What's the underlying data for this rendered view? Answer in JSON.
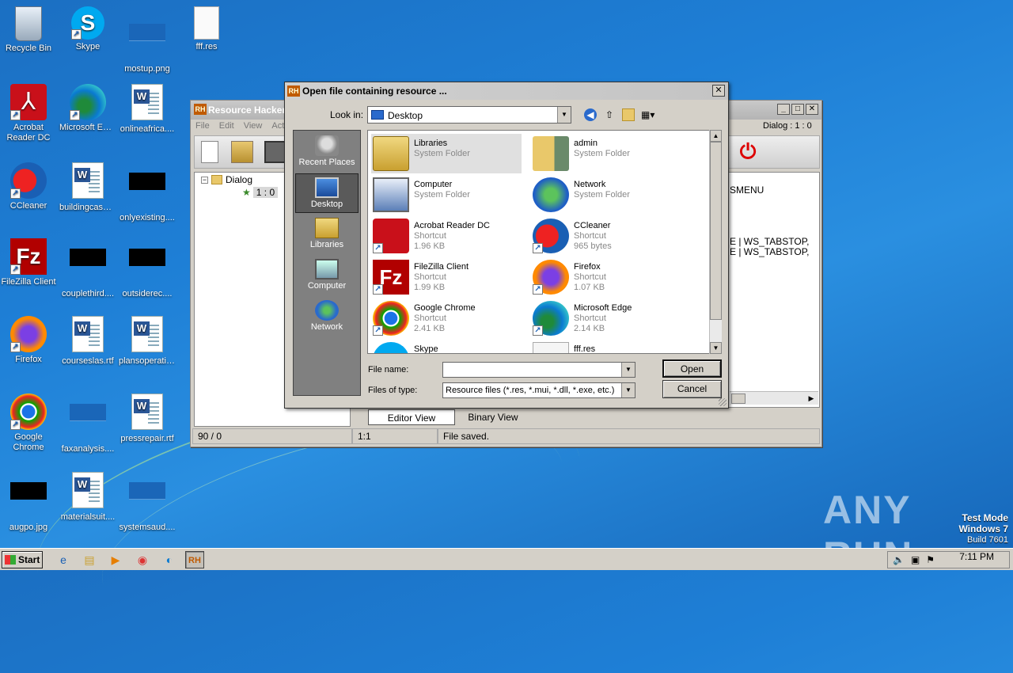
{
  "desktop": {
    "icons": [
      {
        "label": "Recycle Bin"
      },
      {
        "label": "Skype"
      },
      {
        "label": "mostup.png"
      },
      {
        "label": "fff.res"
      },
      {
        "label": "Acrobat Reader DC"
      },
      {
        "label": "Microsoft Edge"
      },
      {
        "label": "onlineafrica...."
      },
      {
        "label": "CCleaner"
      },
      {
        "label": "buildingcash...."
      },
      {
        "label": "onlyexisting...."
      },
      {
        "label": "FileZilla Client"
      },
      {
        "label": "couplethird...."
      },
      {
        "label": "outsiderec...."
      },
      {
        "label": "Firefox"
      },
      {
        "label": "courseslas.rtf"
      },
      {
        "label": "plansoperati...."
      },
      {
        "label": "Google Chrome"
      },
      {
        "label": "faxanalysis...."
      },
      {
        "label": "pressrepair.rtf"
      },
      {
        "label": "augpo.jpg"
      },
      {
        "label": "materialsuit...."
      },
      {
        "label": "systemsaud...."
      }
    ]
  },
  "rh_window": {
    "title": "Resource Hacker",
    "menu": [
      "File",
      "Edit",
      "View",
      "Acti"
    ],
    "dialog_label": "Dialog : 1 : 0",
    "tree_root": "Dialog",
    "tree_child": "1 : 0",
    "editor_lines": "SMENU\n\n\n\n\nE | WS_TABSTOP,\nE | WS_TABSTOP,",
    "tabs": {
      "editor": "Editor View",
      "binary": "Binary View"
    },
    "status": {
      "position": "90 / 0",
      "cursor": "1:1",
      "message": "File saved."
    }
  },
  "dialog": {
    "title": "Open file containing resource ...",
    "look_in_label": "Look in:",
    "look_in_value": "Desktop",
    "places": [
      "Recent Places",
      "Desktop",
      "Libraries",
      "Computer",
      "Network"
    ],
    "files": [
      {
        "name": "Libraries",
        "type": "System Folder",
        "size": ""
      },
      {
        "name": "admin",
        "type": "System Folder",
        "size": ""
      },
      {
        "name": "Computer",
        "type": "System Folder",
        "size": ""
      },
      {
        "name": "Network",
        "type": "System Folder",
        "size": ""
      },
      {
        "name": "Acrobat Reader DC",
        "type": "Shortcut",
        "size": "1.96 KB"
      },
      {
        "name": "CCleaner",
        "type": "Shortcut",
        "size": "965 bytes"
      },
      {
        "name": "FileZilla Client",
        "type": "Shortcut",
        "size": "1.99 KB"
      },
      {
        "name": "Firefox",
        "type": "Shortcut",
        "size": "1.07 KB"
      },
      {
        "name": "Google Chrome",
        "type": "Shortcut",
        "size": "2.41 KB"
      },
      {
        "name": "Microsoft Edge",
        "type": "Shortcut",
        "size": "2.14 KB"
      },
      {
        "name": "Skype",
        "type": "",
        "size": ""
      },
      {
        "name": "fff.res",
        "type": "",
        "size": ""
      }
    ],
    "file_name_label": "File name:",
    "file_name_value": "",
    "file_type_label": "Files of type:",
    "file_type_value": "Resource files (*.res, *.mui, *.dll, *.exe, etc.)",
    "open_label": "Open",
    "cancel_label": "Cancel"
  },
  "taskbar": {
    "start_label": "Start",
    "clock": "7:11 PM"
  },
  "watermark": {
    "brand": "ANY RUN",
    "line1": "Test Mode",
    "line2": "Windows 7",
    "line3": "Build 7601"
  }
}
